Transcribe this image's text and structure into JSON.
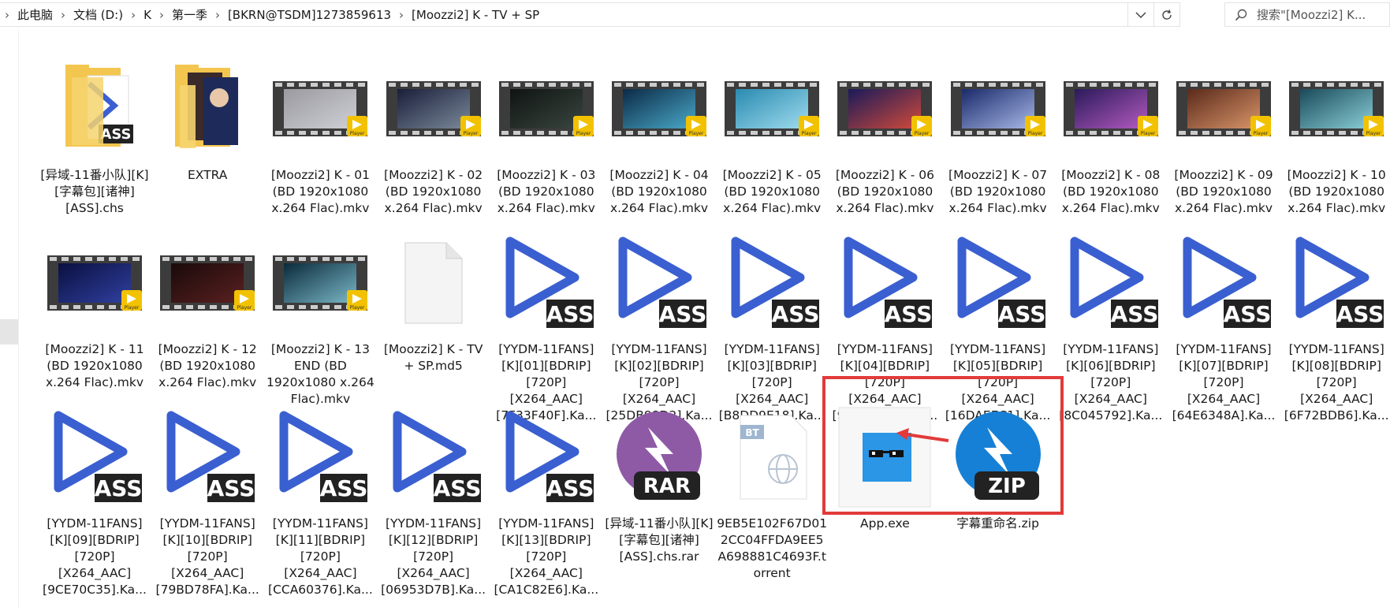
{
  "breadcrumb": [
    "此电脑",
    "文档 (D:)",
    "K",
    "第一季",
    "[BKRN@TSDM]1273859613",
    "[Moozzi2] K - TV + SP"
  ],
  "search": {
    "placeholder": "搜索\"[Moozzi2] K..."
  },
  "icons": {
    "back": "chevron-right-icon",
    "dropdown": "chevron-down-icon",
    "refresh": "refresh-icon",
    "search": "search-icon"
  },
  "colors": {
    "ass_blue": "#3a5fd0",
    "folder": "#f3c64f",
    "highlight": "#e23a3a",
    "rar": "#8e5aa6",
    "zip": "#1680d6",
    "exe": "#2b95e6"
  },
  "files": [
    {
      "label": "[异域-11番小队][K][字幕包][诸神][ASS].chs",
      "type": "folder-ass"
    },
    {
      "label": "EXTRA",
      "type": "folder-extra"
    },
    {
      "label": "[Moozzi2] K - 01 (BD 1920x1080 x.264 Flac).mkv",
      "type": "video",
      "thumb": [
        "#9a9aa0",
        "#cfcfd6"
      ]
    },
    {
      "label": "[Moozzi2] K - 02 (BD 1920x1080 x.264 Flac).mkv",
      "type": "video",
      "thumb": [
        "#1a1e3a",
        "#7a8a9a"
      ]
    },
    {
      "label": "[Moozzi2] K - 03 (BD 1920x1080 x.264 Flac).mkv",
      "type": "video",
      "thumb": [
        "#0f1412",
        "#3a4640"
      ]
    },
    {
      "label": "[Moozzi2] K - 04 (BD 1920x1080 x.264 Flac).mkv",
      "type": "video",
      "thumb": [
        "#0b2a46",
        "#4aa9c9"
      ]
    },
    {
      "label": "[Moozzi2] K - 05 (BD 1920x1080 x.264 Flac).mkv",
      "type": "video",
      "thumb": [
        "#2a8ab0",
        "#9fdcef"
      ]
    },
    {
      "label": "[Moozzi2] K - 06 (BD 1920x1080 x.264 Flac).mkv",
      "type": "video",
      "thumb": [
        "#1a1a5a",
        "#d14a3a"
      ]
    },
    {
      "label": "[Moozzi2] K - 07 (BD 1920x1080 x.264 Flac).mkv",
      "type": "video",
      "thumb": [
        "#1a2a6a",
        "#a8b8e8"
      ]
    },
    {
      "label": "[Moozzi2] K - 08 (BD 1920x1080 x.264 Flac).mkv",
      "type": "video",
      "thumb": [
        "#2a1a5a",
        "#b45ac0"
      ]
    },
    {
      "label": "[Moozzi2] K - 09 (BD 1920x1080 x.264 Flac).mkv",
      "type": "video",
      "thumb": [
        "#5a2a1a",
        "#d9956a"
      ]
    },
    {
      "label": "[Moozzi2] K - 10 (BD 1920x1080 x.264 Flac).mkv",
      "type": "video",
      "thumb": [
        "#1a4a5a",
        "#8ad0d8"
      ]
    },
    {
      "label": "[Moozzi2] K - 11 (BD 1920x1080 x.264 Flac).mkv",
      "type": "video",
      "thumb": [
        "#0a1040",
        "#3040a0"
      ]
    },
    {
      "label": "[Moozzi2] K - 12 (BD 1920x1080 x.264 Flac).mkv",
      "type": "video",
      "thumb": [
        "#1a0a0a",
        "#5a2020"
      ]
    },
    {
      "label": "[Moozzi2] K - 13 END (BD 1920x1080 x.264 Flac).mkv",
      "type": "video",
      "thumb": [
        "#0a2a3a",
        "#7ab8c8"
      ]
    },
    {
      "label": "[Moozzi2] K - TV + SP.md5",
      "type": "blank"
    },
    {
      "label": "[YYDM-11FANS][K][01][BDRIP][720P][X264_AAC][7F33F40F].Ka...",
      "type": "ass"
    },
    {
      "label": "[YYDM-11FANS][K][02][BDRIP][720P][X264_AAC][25DB98D2].Ka...",
      "type": "ass"
    },
    {
      "label": "[YYDM-11FANS][K][03][BDRIP][720P][X264_AAC][B8DD9E18].Ka...",
      "type": "ass"
    },
    {
      "label": "[YYDM-11FANS][K][04][BDRIP][720P][X264_AAC][91B2DB88].Ka...",
      "type": "ass"
    },
    {
      "label": "[YYDM-11FANS][K][05][BDRIP][720P][X264_AAC][16DAEEC1].Ka...",
      "type": "ass"
    },
    {
      "label": "[YYDM-11FANS][K][06][BDRIP][720P][X264_AAC][8C045792].Ka...",
      "type": "ass"
    },
    {
      "label": "[YYDM-11FANS][K][07][BDRIP][720P][X264_AAC][64E6348A].Ka...",
      "type": "ass"
    },
    {
      "label": "[YYDM-11FANS][K][08][BDRIP][720P][X264_AAC][6F72BDB6].Ka...",
      "type": "ass"
    },
    {
      "label": "[YYDM-11FANS][K][09][BDRIP][720P][X264_AAC][9CE70C35].Ka...",
      "type": "ass"
    },
    {
      "label": "[YYDM-11FANS][K][10][BDRIP][720P][X264_AAC][79BD78FA].Ka...",
      "type": "ass"
    },
    {
      "label": "[YYDM-11FANS][K][11][BDRIP][720P][X264_AAC][CCA60376].Ka...",
      "type": "ass"
    },
    {
      "label": "[YYDM-11FANS][K][12][BDRIP][720P][X264_AAC][06953D7B].Ka...",
      "type": "ass"
    },
    {
      "label": "[YYDM-11FANS][K][13][BDRIP][720P][X264_AAC][CA1C82E6].Ka...",
      "type": "ass"
    },
    {
      "label": "[异域-11番小队][K][字幕包][诸神][ASS].chs.rar",
      "type": "rar"
    },
    {
      "label": "9EB5E102F67D012CC04FFDA9EE5A698881C4693F.torrent",
      "type": "torrent"
    },
    {
      "label": "App.exe",
      "type": "exe"
    },
    {
      "label": "字幕重命名.zip",
      "type": "zip"
    }
  ],
  "badges": {
    "player": "Player",
    "ass": "ASS",
    "rar": "RAR",
    "zip": "ZIP",
    "bt": "BT"
  }
}
